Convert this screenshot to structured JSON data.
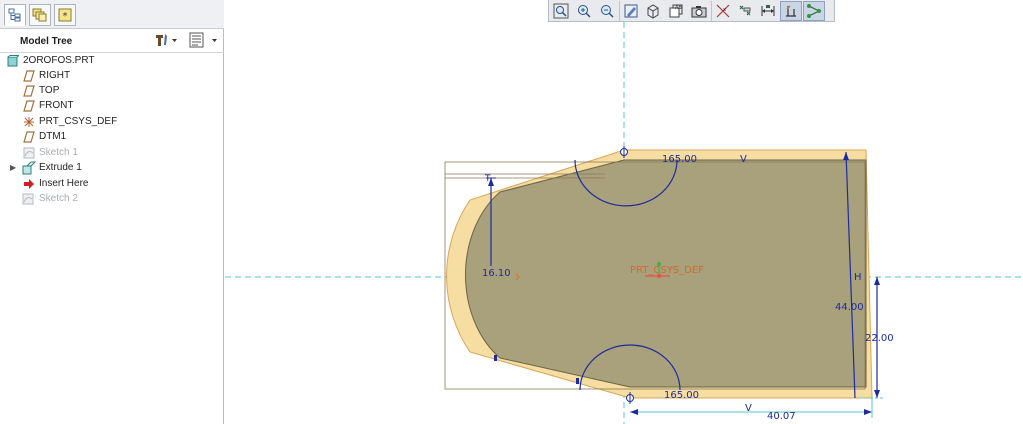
{
  "tabs": [
    {
      "name": "model-tree-tab",
      "icon": "tree-icon"
    },
    {
      "name": "layers-tab",
      "icon": "layers-icon"
    },
    {
      "name": "favorites-tab",
      "icon": "favorites-icon"
    }
  ],
  "model_tree": {
    "title": "Model Tree",
    "settings_icon": "tools-icon",
    "show_icon": "list-icon",
    "items": [
      {
        "label": "2OROFOS.PRT",
        "icon": "part-icon",
        "state": "normal"
      },
      {
        "label": "RIGHT",
        "icon": "datum-plane-icon",
        "state": "normal"
      },
      {
        "label": "TOP",
        "icon": "datum-plane-icon",
        "state": "normal"
      },
      {
        "label": "FRONT",
        "icon": "datum-plane-icon",
        "state": "normal"
      },
      {
        "label": "PRT_CSYS_DEF",
        "icon": "csys-icon",
        "state": "normal"
      },
      {
        "label": "DTM1",
        "icon": "datum-plane-icon",
        "state": "normal"
      },
      {
        "label": "Sketch 1",
        "icon": "sketch-icon",
        "state": "suppressed"
      },
      {
        "label": "Extrude 1",
        "icon": "extrude-icon",
        "state": "normal",
        "expandable": true
      },
      {
        "label": "Insert Here",
        "icon": "insert-arrow-icon",
        "state": "normal"
      },
      {
        "label": "Sketch 2",
        "icon": "sketch-icon",
        "state": "suppressed"
      }
    ]
  },
  "toolbar": [
    {
      "name": "refit-button",
      "icon": "zoom-fit-icon"
    },
    {
      "name": "zoom-in-button",
      "icon": "zoom-in-icon"
    },
    {
      "name": "zoom-out-button",
      "icon": "zoom-out-icon"
    },
    {
      "name": "repaint-button",
      "icon": "repaint-icon"
    },
    {
      "name": "display-style-button",
      "icon": "cube-icon"
    },
    {
      "name": "saved-views-button",
      "icon": "saved-views-icon"
    },
    {
      "name": "view-manager-button",
      "icon": "camera-icon"
    },
    {
      "name": "datum-axes-button",
      "icon": "axes-icon"
    },
    {
      "name": "datum-points-button",
      "icon": "points-icon"
    },
    {
      "name": "dimension-display-button",
      "icon": "dimension-icon"
    },
    {
      "name": "constraints-display-button",
      "icon": "constraint-icon",
      "active": true
    },
    {
      "name": "vertex-display-button",
      "icon": "vertex-icon",
      "active": true
    }
  ],
  "sketch": {
    "csys_label": "PRT_CSYS_DEF",
    "dimensions": {
      "top_radius": "165.00",
      "bottom_radius": "165.00",
      "left_height": "16.10",
      "total_height": "44.00",
      "half_height": "22.00",
      "bottom_width": "40.07"
    },
    "constraints": {
      "v_top": "V",
      "v_bottom": "V",
      "h_right": "H",
      "t_top_left": "T"
    },
    "colors": {
      "outer_face": "#f6dea3",
      "outer_edge": "#d7a656",
      "inner_face": "#a9a17b",
      "dimension": "#1c2b9e",
      "centerline": "#4fc7cf"
    }
  }
}
